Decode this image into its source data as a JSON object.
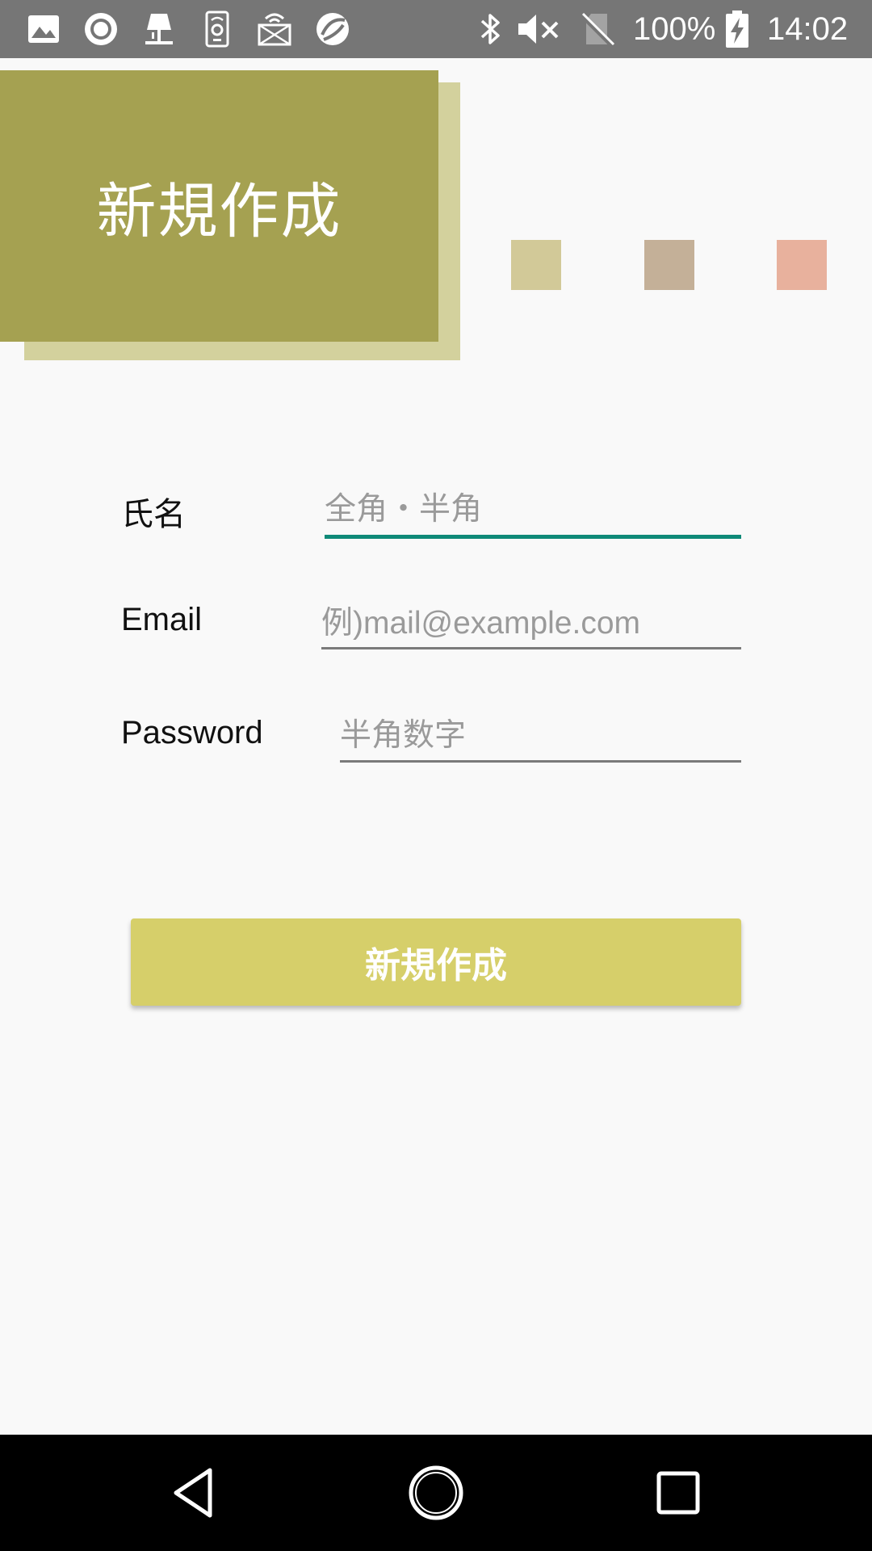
{
  "status_bar": {
    "battery": "100%",
    "time": "14:02",
    "icons": [
      "image-icon",
      "record-icon",
      "lamp-icon",
      "phone-settings-icon",
      "wifi-router-icon",
      "sync-app-icon",
      "bluetooth-icon",
      "mute-icon",
      "no-sim-icon",
      "battery-charging-icon"
    ]
  },
  "header": {
    "title": "新規作成",
    "block_color": "#a5a151",
    "shadow_color": "#d3d19d",
    "swatches": [
      "#d2c998",
      "#c4b098",
      "#e8b19d"
    ]
  },
  "form": {
    "name": {
      "label": "氏名",
      "placeholder": "全角・半角",
      "value": ""
    },
    "email": {
      "label": "Email",
      "placeholder": "例)mail@example.com",
      "value": ""
    },
    "password": {
      "label": "Password",
      "placeholder": "半角数字",
      "value": ""
    }
  },
  "submit_button": {
    "label": "新規作成",
    "color": "#d6cf6a"
  },
  "nav_bar": {
    "buttons": [
      "back-icon",
      "home-icon",
      "recents-icon"
    ]
  }
}
